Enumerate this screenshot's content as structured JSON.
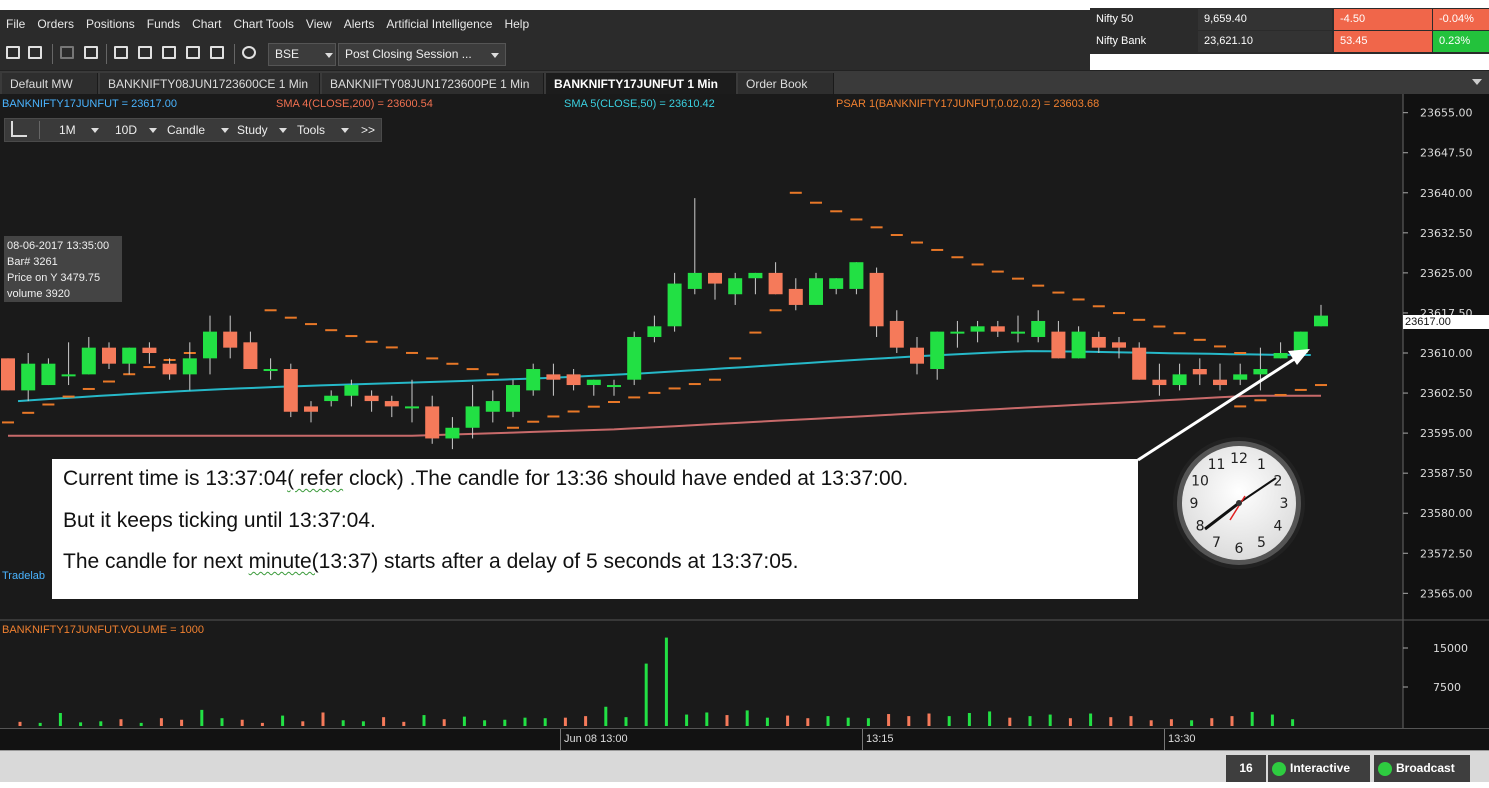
{
  "menu": [
    "File",
    "Orders",
    "Positions",
    "Funds",
    "Chart",
    "Chart Tools",
    "View",
    "Alerts",
    "Artificial Intelligence",
    "Help"
  ],
  "ticker": [
    {
      "name": "Nifty 50",
      "value": "9,659.40",
      "change": "-4.50",
      "pct": "-0.04%",
      "color": "#f0664a"
    },
    {
      "name": "Nifty Bank",
      "value": "23,621.10",
      "change": "53.45",
      "pct": "0.23%",
      "color": "#23c23c"
    }
  ],
  "toolbar": {
    "exchange": "BSE",
    "session": "Post Closing Session ..."
  },
  "tabs": [
    {
      "label": "Default MW",
      "active": false
    },
    {
      "label": "BANKNIFTY08JUN1723600CE 1 Min",
      "active": false
    },
    {
      "label": "BANKNIFTY08JUN1723600PE 1 Min",
      "active": false
    },
    {
      "label": "BANKNIFTY17JUNFUT 1 Min",
      "active": true
    },
    {
      "label": "Order Book",
      "active": false
    }
  ],
  "tab_close": "✕",
  "indicators": {
    "symbol": "BANKNIFTY17JUNFUT = 23617.00",
    "sma4": "SMA 4(CLOSE,200) = 23600.54",
    "sma5": "SMA 5(CLOSE,50) = 23610.42",
    "psar": "PSAR 1(BANKNIFTY17JUNFUT,0.02,0.2) = 23603.68",
    "volume": "BANKNIFTY17JUNFUT.VOLUME = 1000",
    "watermark": "Tradelab"
  },
  "chart_tools": {
    "interval": "1M",
    "range": "10D",
    "type": "Candle",
    "study": "Study",
    "tools": "Tools",
    "more": ">>"
  },
  "info": {
    "datetime": "08-06-2017 13:35:00",
    "bar": "Bar# 3261",
    "price": "Price on Y  3479.75",
    "volume": "volume  3920"
  },
  "price_tag": "23617.00",
  "annotation": {
    "line1_a": "Current time is 13:37:04",
    "line1_b": "( refer",
    "line1_c": " clock) .The candle for 13:36 should have ended at 13:37:00.",
    "line2": "But it keeps ticking until 13:37:04.",
    "line3_a": "The candle for next ",
    "line3_b": "minute(",
    "line3_c": "13:37)  starts after a delay of 5 seconds at 13:37:05."
  },
  "clock": {
    "numbers": [
      "12",
      "1",
      "2",
      "3",
      "4",
      "5",
      "6",
      "7",
      "8",
      "9",
      "10",
      "11"
    ]
  },
  "status": {
    "count": "16",
    "interactive": "Interactive",
    "broadcast": "Broadcast"
  },
  "chart_data": {
    "type": "candlestick",
    "price_axis": {
      "min": 23563,
      "max": 23657,
      "ticks": [
        "23655.00",
        "23647.50",
        "23640.00",
        "23632.50",
        "23625.00",
        "23617.50",
        "23610.00",
        "23602.50",
        "23595.00",
        "23587.50",
        "23580.00",
        "23572.50",
        "23565.00"
      ]
    },
    "volume_axis": {
      "max": 20000,
      "ticks": [
        "15000",
        "7500"
      ]
    },
    "time_labels": [
      "Jun 08 13:00",
      "13:15",
      "13:30"
    ],
    "colors": {
      "up": "#22e044",
      "down": "#f57a5a",
      "sma5": "#26b8c8",
      "sma4": "#c86a6a",
      "psar": "#e87828"
    },
    "candles": [
      {
        "o": 23609,
        "h": 23605,
        "l": 23603,
        "c": 23603
      },
      {
        "o": 23603,
        "h": 23610,
        "l": 23601,
        "c": 23608
      },
      {
        "o": 23604,
        "h": 23609,
        "l": 23604,
        "c": 23608
      },
      {
        "o": 23606,
        "h": 23612,
        "l": 23604,
        "c": 23606
      },
      {
        "o": 23606,
        "h": 23613,
        "l": 23606,
        "c": 23611
      },
      {
        "o": 23611,
        "h": 23612,
        "l": 23607,
        "c": 23608
      },
      {
        "o": 23608,
        "h": 23611,
        "l": 23606,
        "c": 23611
      },
      {
        "o": 23611,
        "h": 23612,
        "l": 23608,
        "c": 23610
      },
      {
        "o": 23608,
        "h": 23609,
        "l": 23605,
        "c": 23606
      },
      {
        "o": 23606,
        "h": 23612,
        "l": 23603,
        "c": 23609
      },
      {
        "o": 23609,
        "h": 23617,
        "l": 23606,
        "c": 23614
      },
      {
        "o": 23614,
        "h": 23617,
        "l": 23609,
        "c": 23611
      },
      {
        "o": 23612,
        "h": 23614,
        "l": 23607,
        "c": 23607
      },
      {
        "o": 23607,
        "h": 23609,
        "l": 23605,
        "c": 23607
      },
      {
        "o": 23607,
        "h": 23608,
        "l": 23598,
        "c": 23599
      },
      {
        "o": 23600,
        "h": 23601,
        "l": 23597,
        "c": 23599
      },
      {
        "o": 23601,
        "h": 23603,
        "l": 23600,
        "c": 23602
      },
      {
        "o": 23602,
        "h": 23605,
        "l": 23600,
        "c": 23604
      },
      {
        "o": 23602,
        "h": 23603,
        "l": 23599,
        "c": 23601
      },
      {
        "o": 23601,
        "h": 23602,
        "l": 23598,
        "c": 23600
      },
      {
        "o": 23600,
        "h": 23605,
        "l": 23597,
        "c": 23600
      },
      {
        "o": 23600,
        "h": 23602,
        "l": 23593,
        "c": 23594
      },
      {
        "o": 23594,
        "h": 23598,
        "l": 23592,
        "c": 23596
      },
      {
        "o": 23596,
        "h": 23604,
        "l": 23594,
        "c": 23600
      },
      {
        "o": 23599,
        "h": 23603,
        "l": 23597,
        "c": 23601
      },
      {
        "o": 23599,
        "h": 23605,
        "l": 23598,
        "c": 23604
      },
      {
        "o": 23603,
        "h": 23608,
        "l": 23602,
        "c": 23607
      },
      {
        "o": 23606,
        "h": 23608,
        "l": 23602,
        "c": 23605
      },
      {
        "o": 23606,
        "h": 23607,
        "l": 23603,
        "c": 23604
      },
      {
        "o": 23604,
        "h": 23605,
        "l": 23602,
        "c": 23605
      },
      {
        "o": 23604,
        "h": 23605,
        "l": 23602,
        "c": 23604
      },
      {
        "o": 23605,
        "h": 23614,
        "l": 23604,
        "c": 23613
      },
      {
        "o": 23613,
        "h": 23617,
        "l": 23612,
        "c": 23615
      },
      {
        "o": 23615,
        "h": 23625,
        "l": 23614,
        "c": 23623
      },
      {
        "o": 23622,
        "h": 23639,
        "l": 23621,
        "c": 23625
      },
      {
        "o": 23625,
        "h": 23625,
        "l": 23620,
        "c": 23623
      },
      {
        "o": 23621,
        "h": 23625,
        "l": 23619,
        "c": 23624
      },
      {
        "o": 23624,
        "h": 23625,
        "l": 23621,
        "c": 23625
      },
      {
        "o": 23625,
        "h": 23627,
        "l": 23621,
        "c": 23621
      },
      {
        "o": 23622,
        "h": 23624,
        "l": 23618,
        "c": 23619
      },
      {
        "o": 23619,
        "h": 23625,
        "l": 23619,
        "c": 23624
      },
      {
        "o": 23622,
        "h": 23624,
        "l": 23621,
        "c": 23624
      },
      {
        "o": 23622,
        "h": 23627,
        "l": 23621,
        "c": 23627
      },
      {
        "o": 23625,
        "h": 23626,
        "l": 23613,
        "c": 23615
      },
      {
        "o": 23616,
        "h": 23618,
        "l": 23610,
        "c": 23611
      },
      {
        "o": 23611,
        "h": 23613,
        "l": 23606,
        "c": 23608
      },
      {
        "o": 23607,
        "h": 23614,
        "l": 23605,
        "c": 23614
      },
      {
        "o": 23614,
        "h": 23616,
        "l": 23611,
        "c": 23614
      },
      {
        "o": 23614,
        "h": 23616,
        "l": 23612,
        "c": 23615
      },
      {
        "o": 23615,
        "h": 23616,
        "l": 23613,
        "c": 23614
      },
      {
        "o": 23614,
        "h": 23617,
        "l": 23612,
        "c": 23614
      },
      {
        "o": 23613,
        "h": 23618,
        "l": 23612,
        "c": 23616
      },
      {
        "o": 23614,
        "h": 23616,
        "l": 23609,
        "c": 23609
      },
      {
        "o": 23609,
        "h": 23615,
        "l": 23609,
        "c": 23614
      },
      {
        "o": 23613,
        "h": 23614,
        "l": 23610,
        "c": 23611
      },
      {
        "o": 23612,
        "h": 23613,
        "l": 23609,
        "c": 23611
      },
      {
        "o": 23611,
        "h": 23612,
        "l": 23605,
        "c": 23605
      },
      {
        "o": 23605,
        "h": 23608,
        "l": 23602,
        "c": 23604
      },
      {
        "o": 23604,
        "h": 23608,
        "l": 23603,
        "c": 23606
      },
      {
        "o": 23607,
        "h": 23609,
        "l": 23604,
        "c": 23606
      },
      {
        "o": 23605,
        "h": 23608,
        "l": 23603,
        "c": 23604
      },
      {
        "o": 23605,
        "h": 23608,
        "l": 23604,
        "c": 23606
      },
      {
        "o": 23606,
        "h": 23611,
        "l": 23603,
        "c": 23607
      },
      {
        "o": 23609,
        "h": 23612,
        "l": 23609,
        "c": 23610
      },
      {
        "o": 23610,
        "h": 23614,
        "l": 23609,
        "c": 23614
      },
      {
        "o": 23615,
        "h": 23619,
        "l": 23615,
        "c": 23617
      }
    ],
    "sma5": [
      23598,
      23599,
      23600,
      23601,
      23602,
      23603,
      23604,
      23605,
      23606,
      23606,
      23607,
      23609,
      23611,
      23612,
      23612,
      23613,
      23614,
      23614,
      23615,
      23615,
      23615,
      23615,
      23615,
      23615,
      23615,
      23615,
      23615,
      23615,
      23615,
      23615,
      23615,
      23615,
      23615,
      23615,
      23615,
      23615,
      23615,
      23615,
      23615,
      23615,
      23615,
      23615,
      23615,
      23615,
      23615,
      23615,
      23615,
      23615,
      23615
    ],
    "psar": [
      23598,
      23610,
      23618,
      23618,
      23614,
      23604,
      23600,
      23603,
      23608,
      23613,
      23635,
      23624,
      23620,
      23618,
      23612,
      23606,
      23603,
      23604
    ],
    "volume": [
      800,
      600,
      2500,
      700,
      900,
      1300,
      600,
      1500,
      1200,
      3100,
      1500,
      1200,
      600,
      2000,
      900,
      2600,
      1100,
      900,
      1700,
      800,
      2100,
      1300,
      1800,
      1100,
      1200,
      1600,
      1500,
      1600,
      1900,
      3700,
      1700,
      12000,
      17000,
      2200,
      2600,
      2100,
      3000,
      1600,
      2000,
      1500,
      1900,
      1600,
      1500,
      2300,
      1900,
      2400,
      1900,
      2500,
      2800,
      1600,
      1900,
      2200,
      1500,
      2400,
      1700,
      1900,
      1100,
      1300,
      1100,
      1500,
      1900,
      2700,
      2200,
      1300
    ]
  }
}
